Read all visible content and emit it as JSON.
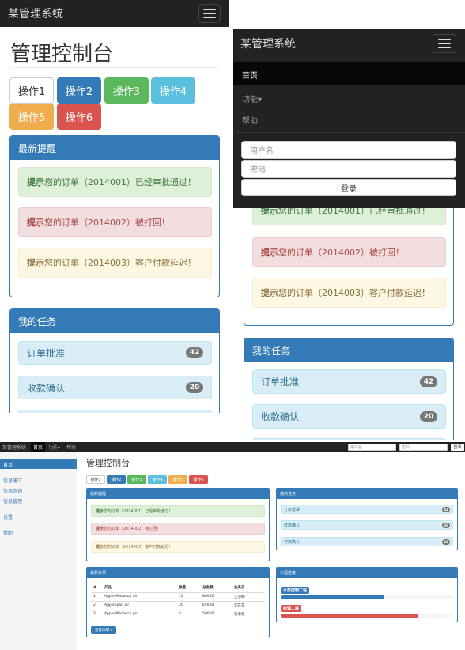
{
  "brand": "某管理系统",
  "page_title": "管理控制台",
  "actions": [
    {
      "label": "操作1",
      "color": "#ffffff"
    },
    {
      "label": "操作2",
      "color": "#337ab7"
    },
    {
      "label": "操作3",
      "color": "#5cb85c"
    },
    {
      "label": "操作4",
      "color": "#5bc0de"
    },
    {
      "label": "操作5",
      "color": "#f0ad4e"
    },
    {
      "label": "操作6",
      "color": "#d9534f"
    }
  ],
  "alerts_panel": {
    "title": "最新提醒",
    "alerts": [
      {
        "prefix": "提示",
        "text": "您的订单（2014001）已经审批通过！"
      },
      {
        "prefix": "提示",
        "text": "您的订单（2014002）被打回！"
      },
      {
        "prefix": "提示",
        "text": "您的订单（2014003）客户付款延迟！"
      }
    ]
  },
  "tasks_panel": {
    "title": "我的任务",
    "items": [
      {
        "label": "订单批准",
        "count": "42"
      },
      {
        "label": "收款确认",
        "count": "20"
      },
      {
        "label": "付款确认",
        "count": "10"
      }
    ]
  },
  "mobile_menu": {
    "items": [
      "首页",
      "功能",
      "帮助"
    ],
    "username_placeholder": "用户名...",
    "password_placeholder": "密码...",
    "login_label": "登录"
  },
  "sidebar": {
    "home": "首页",
    "items": [
      "信息建立",
      "信息查询",
      "信息管理"
    ],
    "settings": "设置",
    "help": "帮助"
  },
  "orders_panel": {
    "title": "最新订单",
    "headers": [
      "#",
      "产品",
      "数量",
      "总金额",
      "业务员"
    ],
    "rows": [
      [
        "1",
        "Apple Macbook air",
        "10",
        "80000",
        "王小明"
      ],
      [
        "2",
        "Apple ipad air",
        "20",
        "65000",
        "李开花"
      ],
      [
        "3",
        "Apple Macbook pro",
        "5",
        "50000",
        "刘老根"
      ]
    ],
    "more_label": "查看详细 »"
  },
  "progress_panel": {
    "title": "工程进度",
    "items": [
      {
        "label": "水务控制工程",
        "color": "#337ab7",
        "fraction": 0.6
      },
      {
        "label": "能源工程",
        "color": "#d9534f",
        "fraction": 0.8
      }
    ]
  }
}
